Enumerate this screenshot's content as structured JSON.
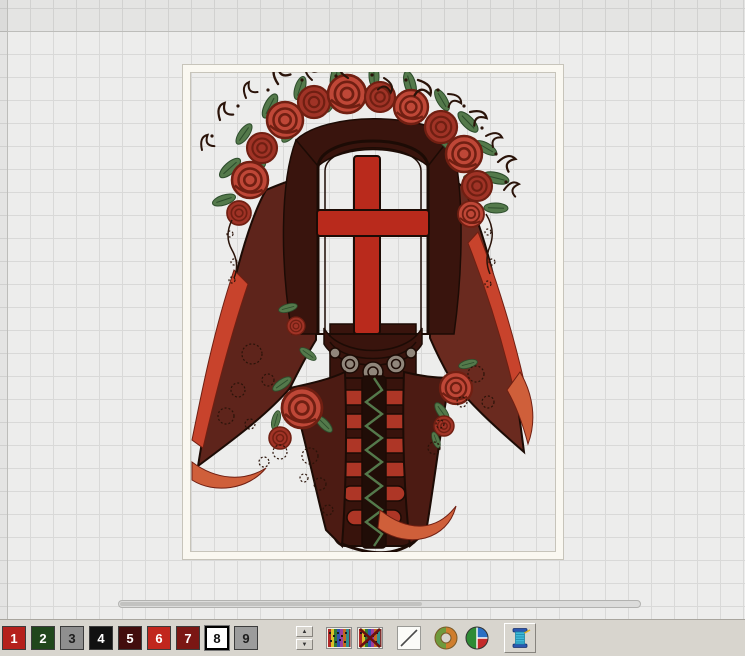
{
  "theme": {
    "canvas_bg": "#ededec",
    "grid_line": "#d9d9d8",
    "margin_shade": "rgba(90,90,90,0.06)",
    "page_edge": "#bdbdba",
    "hoop_frame": "#faf8f1",
    "hoop_edge": "#c7c4ba",
    "toolbar_bg": "#d8d5ce",
    "toolbar_edge": "#a8a59e",
    "button_face": "#d8d5ce",
    "button_hi": "#ffffff",
    "button_lo": "#87847e",
    "scroll_track": "#dcdcdb",
    "scroll_edge": "#b2b2b0",
    "scroll_thumb": "#c2c2c0"
  },
  "design": {
    "colors": {
      "rose_red": "#bf4737",
      "rose_deep": "#a03326",
      "rose_dark": "#701f12",
      "leaf_green": "#54794b",
      "leaf_dark": "#2d4d2c",
      "veil_maroon": "#5e241b",
      "veil_maroon2": "#6a2a1f",
      "veil_fold": "#4c1b13",
      "veil_dark": "#38130c",
      "hair_brown": "#39140d",
      "outline": "#1c0b05",
      "window_red": "#b92a1c",
      "bar_red": "#ae3626",
      "ribbon_red": "#c8432c",
      "ribbon_orange": "#cf5f3a",
      "metal_gray": "#90867b",
      "lace_dark": "#2a1309"
    }
  },
  "toolbar": {
    "palette": [
      {
        "number": "1",
        "color": "#b5201b",
        "text": "#ffffff",
        "selected": false
      },
      {
        "number": "2",
        "color": "#20471c",
        "text": "#ffffff",
        "selected": false
      },
      {
        "number": "3",
        "color": "#8f8f8f",
        "text": "#1d1d1d",
        "selected": false
      },
      {
        "number": "4",
        "color": "#111111",
        "text": "#ffffff",
        "selected": false
      },
      {
        "number": "5",
        "color": "#420d0d",
        "text": "#ffffff",
        "selected": false
      },
      {
        "number": "6",
        "color": "#c1261d",
        "text": "#ffffff",
        "selected": false
      },
      {
        "number": "7",
        "color": "#7b1714",
        "text": "#ffffff",
        "selected": false
      },
      {
        "number": "8",
        "color": "#ffffff",
        "text": "#111111",
        "selected": true
      },
      {
        "number": "9",
        "color": "#9c9c9c",
        "text": "#1d1d1d",
        "selected": false
      }
    ],
    "spinner_up": "▲",
    "spinner_down": "▼",
    "icons": [
      {
        "name": "thread-chart-icon"
      },
      {
        "name": "thread-chart-delete-icon"
      },
      {
        "name": "diagonal-stitch-icon"
      },
      {
        "name": "donut-ring-icon"
      },
      {
        "name": "color-sphere-icon"
      },
      {
        "name": "thread-spool-icon"
      }
    ]
  }
}
